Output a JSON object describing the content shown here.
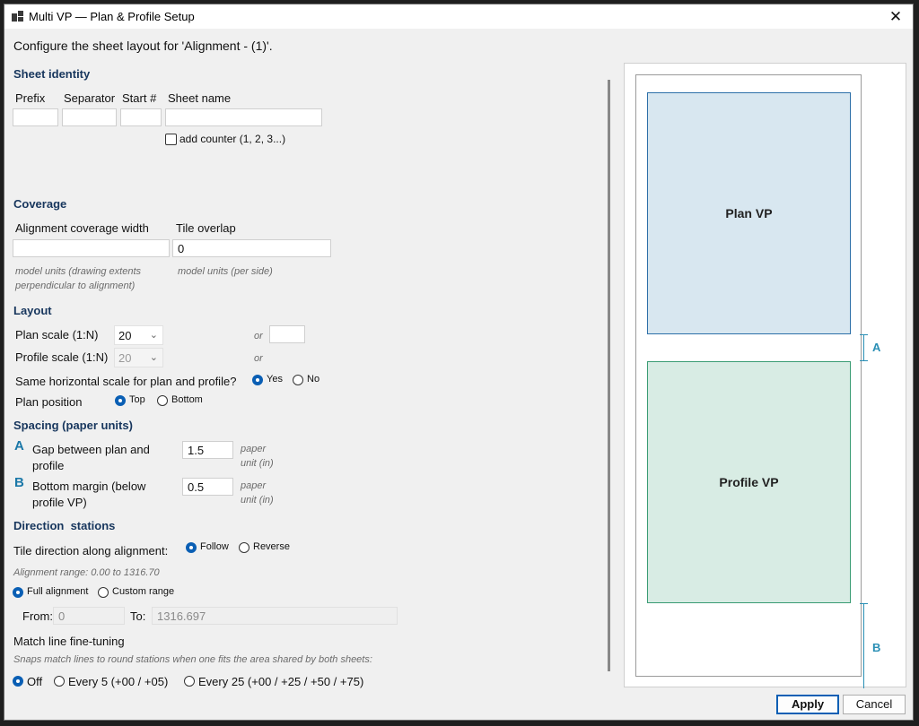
{
  "window": {
    "title": "Multi VP — Plan & Profile Setup"
  },
  "intro": "Configure the sheet layout for 'Alignment - (1)'.",
  "sheet_identity": {
    "heading": "Sheet identity",
    "prefix_label": "Prefix",
    "separator_label": "Separator",
    "start_label": "Start #",
    "sheet_name_label": "Sheet name",
    "prefix_value": "",
    "separator_value": "",
    "start_value": "",
    "sheet_name_value": "",
    "add_counter_label": "add counter (1, 2, 3...)",
    "add_counter_checked": false
  },
  "coverage": {
    "heading": "Coverage",
    "width_label": "Alignment coverage width",
    "width_value": "",
    "width_note": "model units (drawing extents perpendicular to alignment)",
    "overlap_label": "Tile overlap",
    "overlap_value": "0",
    "overlap_note": "model units (per side)"
  },
  "layout": {
    "heading": "Layout",
    "plan_scale_label": "Plan scale (1:N)",
    "plan_scale_value": "20",
    "profile_scale_label": "Profile scale (1:N)",
    "profile_scale_value": "20",
    "or_label": "or",
    "plan_custom_value": "",
    "same_scale_label": "Same horizontal scale for plan and profile?",
    "yes_label": "Yes",
    "no_label": "No",
    "same_scale_selected": "Yes",
    "plan_position_label": "Plan position",
    "top_label": "Top",
    "bottom_label": "Bottom",
    "plan_position_selected": "Top"
  },
  "spacing": {
    "heading": "Spacing (paper units)",
    "gap_letter": "A",
    "gap_label_1": "Gap between plan and",
    "gap_label_2": "profile",
    "gap_value": "1.5",
    "gap_unit_1": "paper",
    "gap_unit_2": "unit (in)",
    "margin_letter": "B",
    "margin_label_1": "Bottom margin (below",
    "margin_label_2": "profile VP)",
    "margin_value": "0.5",
    "margin_unit_1": "paper",
    "margin_unit_2": "unit (in)"
  },
  "direction": {
    "heading": "Direction  stations",
    "tile_direction_label": "Tile direction along alignment:",
    "follow_label": "Follow",
    "reverse_label": "Reverse",
    "direction_selected": "Follow",
    "range_note": "Alignment range: 0.00 to 1316.70",
    "full_label": "Full alignment",
    "custom_label": "Custom range",
    "range_selected": "Full alignment",
    "from_label": "From:",
    "from_value": "0",
    "to_label": "To:",
    "to_value": "1316.697",
    "match_heading": "Match line fine-tuning",
    "match_note": "Snaps match lines to round stations when one fits the area shared by both sheets:",
    "off_label": "Off",
    "every5_label": "Every 5 (+00 / +05)",
    "every25_label": "Every 25 (+00 / +25 / +50 / +75)",
    "match_selected": "Off"
  },
  "preview": {
    "plan_label": "Plan VP",
    "profile_label": "Profile VP",
    "dim_a": "A",
    "dim_b": "B"
  },
  "buttons": {
    "apply": "Apply",
    "cancel": "Cancel"
  },
  "colors": {
    "accent": "#0a5fb4",
    "heading": "#17365d",
    "plan_fill": "#d8e7f0",
    "profile_fill": "#d8ece4",
    "dimension": "#2a8fb5"
  }
}
